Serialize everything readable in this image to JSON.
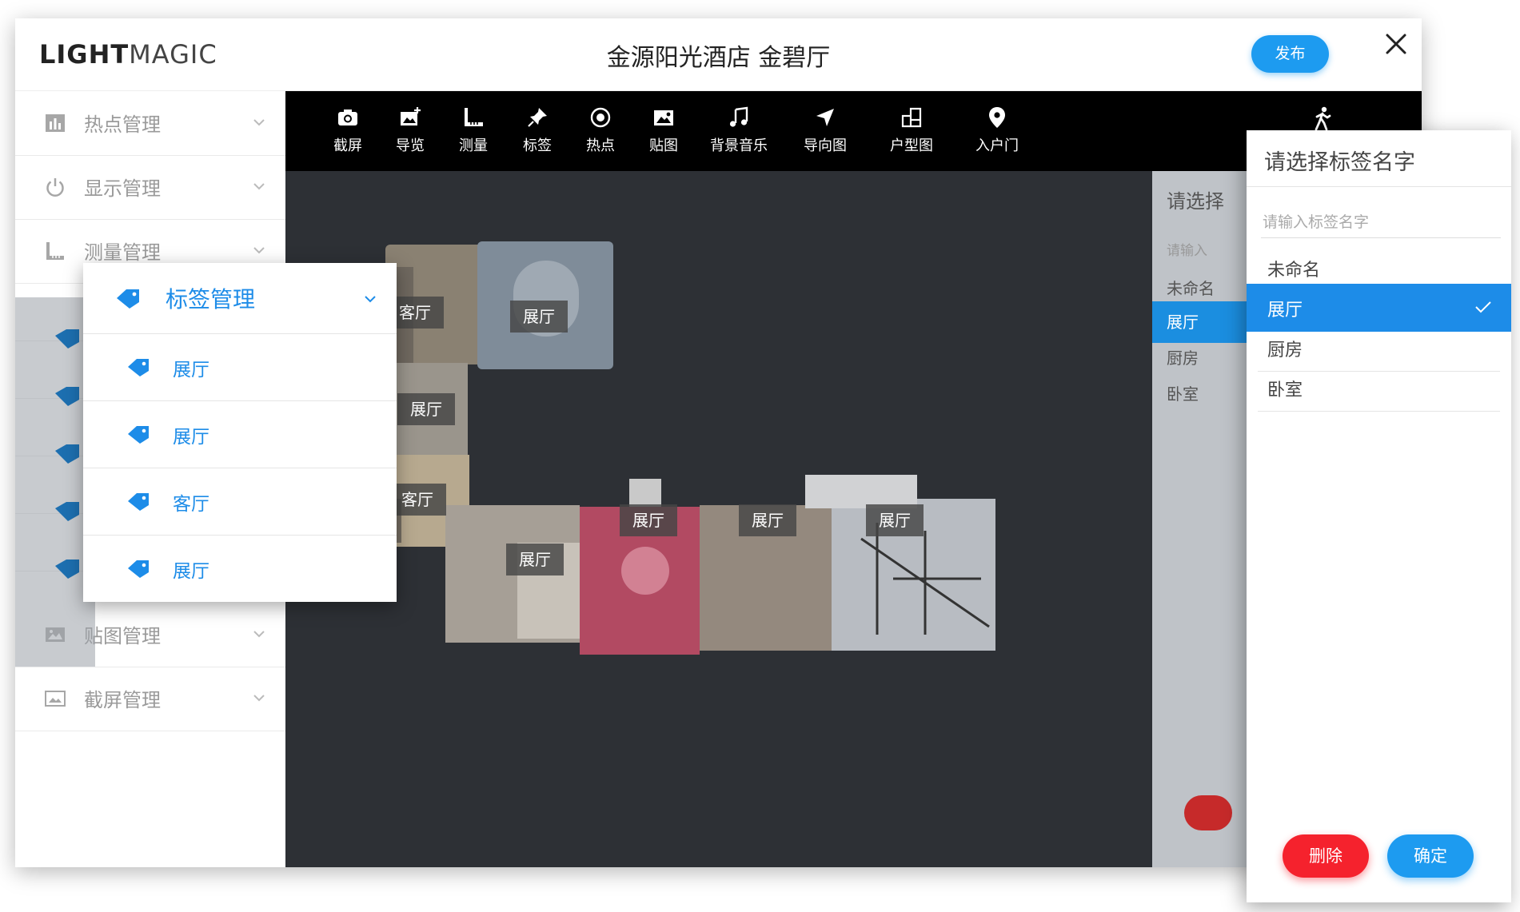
{
  "header": {
    "logo_bold": "LIGHT",
    "logo_light": "MAGIC",
    "title": "金源阳光酒店 金碧厅",
    "publish_label": "发布"
  },
  "sidebar": {
    "items": [
      {
        "label": "热点管理",
        "icon": "bar-chart-icon"
      },
      {
        "label": "显示管理",
        "icon": "power-icon"
      },
      {
        "label": "测量管理",
        "icon": "ruler-icon"
      },
      {
        "label": "贴图管理",
        "icon": "image-icon"
      },
      {
        "label": "截屏管理",
        "icon": "picture-icon"
      }
    ]
  },
  "tag_panel": {
    "title": "标签管理",
    "items": [
      "展厅",
      "展厅",
      "客厅",
      "展厅"
    ]
  },
  "toolbar": {
    "tools": [
      {
        "label": "截屏",
        "icon": "camera-icon"
      },
      {
        "label": "导览",
        "icon": "tour-icon"
      },
      {
        "label": "测量",
        "icon": "ruler-icon"
      },
      {
        "label": "标签",
        "icon": "pin-icon"
      },
      {
        "label": "热点",
        "icon": "hotspot-icon"
      },
      {
        "label": "贴图",
        "icon": "sticker-icon"
      },
      {
        "label": "背景音乐",
        "icon": "music-icon"
      },
      {
        "label": "导向图",
        "icon": "navigation-icon"
      },
      {
        "label": "户型图",
        "icon": "floorplan-icon"
      },
      {
        "label": "入户门",
        "icon": "location-icon"
      }
    ],
    "walk_icon": "walk-icon"
  },
  "model_tags": [
    "客厅",
    "展厅",
    "展厅",
    "客厅",
    "展厅",
    "展厅",
    "展厅",
    "展厅"
  ],
  "back_panel": {
    "title": "请选择",
    "input_fragment": "请输入",
    "rows": [
      "未命名",
      "展厅",
      "厨房",
      "卧室"
    ]
  },
  "right_panel": {
    "title": "请选择标签名字",
    "placeholder": "请输入标签名字",
    "options": [
      "未命名",
      "展厅",
      "厨房",
      "卧室"
    ],
    "selected": "展厅",
    "delete_label": "删除",
    "confirm_label": "确定"
  },
  "colors": {
    "accent": "#1d9bf0",
    "selected_bg": "#1d8ce8",
    "danger": "#f5222d",
    "toolbar_bg": "#000000",
    "viewer_bg": "#2d3035"
  }
}
